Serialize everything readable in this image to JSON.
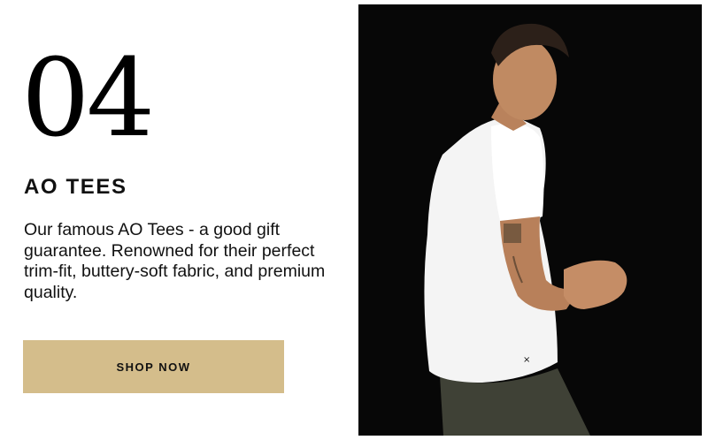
{
  "promo": {
    "number": "04",
    "title": "AO TEES",
    "description": "Our famous AO Tees - a good gift guarantee. Renowned for their perfect trim-fit, buttery-soft fabric, and premium quality.",
    "button_label": "SHOP NOW"
  },
  "photo": {
    "subject": "model-white-tee-photo"
  },
  "colors": {
    "button": "#d4bd8b",
    "photo_background": "#070707",
    "text": "#111111"
  }
}
